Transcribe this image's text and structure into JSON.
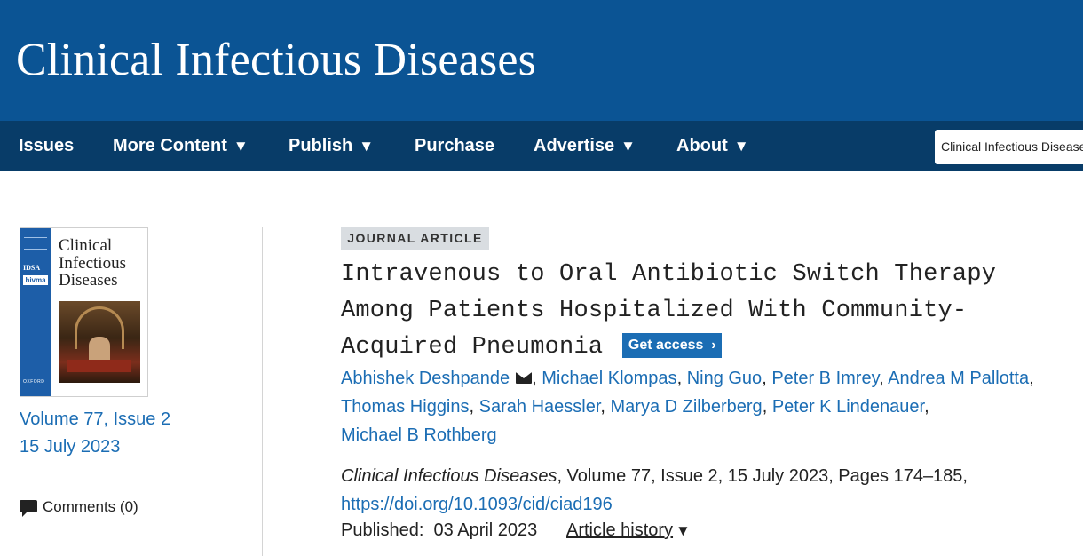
{
  "header": {
    "journal_title": "Clinical Infectious Diseases"
  },
  "nav": {
    "items": [
      {
        "label": "Issues",
        "dropdown": false
      },
      {
        "label": "More Content",
        "dropdown": true
      },
      {
        "label": "Publish",
        "dropdown": true
      },
      {
        "label": "Purchase",
        "dropdown": false
      },
      {
        "label": "Advertise",
        "dropdown": true
      },
      {
        "label": "About",
        "dropdown": true
      }
    ],
    "caret": "▼",
    "search_scope": "Clinical Infectious Diseases"
  },
  "sidebar": {
    "cover": {
      "title_line1": "Clinical",
      "title_line2": "Infectious",
      "title_line3": "Diseases",
      "logo_idsa": "IDSA",
      "logo_hivma": "hivma",
      "publisher": "OXFORD"
    },
    "volume_link": "Volume 77, Issue 2",
    "date_link": "15 July 2023",
    "comments_label": "Comments (0)"
  },
  "article": {
    "type": "JOURNAL ARTICLE",
    "title_lines": [
      "Intravenous to Oral Antibiotic Switch Therapy",
      "Among Patients Hospitalized With Community-",
      "Acquired Pneumonia"
    ],
    "get_access": "Get access",
    "get_access_chevron": "›",
    "authors": [
      "Abhishek Deshpande",
      "Michael Klompas",
      "Ning Guo",
      "Peter B Imrey",
      "Andrea M Pallotta",
      "Thomas Higgins",
      "Sarah Haessler",
      "Marya D Zilberberg",
      "Peter K Lindenauer",
      "Michael B Rothberg"
    ],
    "author_separator": ",",
    "citation_journal": "Clinical Infectious Diseases",
    "citation_rest": ", Volume 77, Issue 2, 15 July 2023, Pages 174–185,",
    "doi": "https://doi.org/10.1093/cid/ciad196",
    "published_label": "Published:",
    "published_date": "03 April 2023",
    "history_label": "Article history",
    "history_caret": "▼"
  },
  "colors": {
    "masthead": "#0b5494",
    "navbar": "#083c68",
    "link": "#1b6db4",
    "tag_bg": "#d9dde1"
  }
}
